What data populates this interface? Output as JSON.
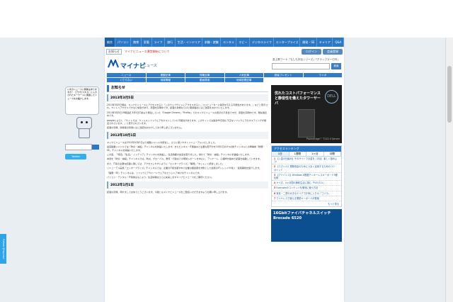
{
  "nav": [
    "総合",
    "パソコン",
    "携帯",
    "家電",
    "ライフ",
    "旅行",
    "生活・\nインテリア",
    "求職・就職",
    "エンタメ",
    "ホビー",
    "デジタル\nライフ",
    "エンター\nプライズ",
    "開発・SE",
    "キャリア",
    "Q&A"
  ],
  "topbar": {
    "tag": "お知らせ",
    "notice": "マイナビニュース運営開始について",
    "login": "ログイン",
    "register": "会員登録"
  },
  "logo": {
    "name": "マイナビ",
    "sub": "ニュース",
    "keyword_line": "急上昇ワード「もしも外伝シリーズ」「グラップラー刃牙」",
    "search_btn": "検索"
  },
  "cats": [
    "ニュース",
    "連載記事",
    "特集記事",
    "人気記事",
    "読者プレゼント",
    "マイボ",
    "くだらない",
    "地域情報",
    "動画検索",
    "地域密着記事"
  ],
  "page_title": "お知らせ",
  "posts": [
    {
      "date": "2013年3月5日",
      "paras": [
        "2013年3月5日現在、マイナビニュースにアクセスすると『このウェブサイトにアクセスすると、コンピューターに損害を与える可能性があります。』などと表示され、サイトへアクセスできない場合があり、原因を究明中です。読者の皆様ならびに関係各社にはご迷惑をおかけいたします。",
        "2013年3月5日19時追記\n3月5日午前より発生していた「Google Chrome」「Firefox」でのマイナビニュースの表示の不具合ですが、原因を究明中です。現在復旧中です。",
        "googleによると\n「サイトでは、ウイルスソフトウェアをホストしていた可能性があります。このサイトでは過去90日間に不正なソフトウェアのホスティングが検出されています。」と表示されています。",
        "読者の皆様、関係者の皆様にはご迷惑をおかけしており申し訳ございません。"
      ]
    },
    {
      "date": "2012年10月1日",
      "paras": [
        "マイナビニュースは2012年10月1日より複数ジャンルを統合し、さらに使いやすくリニューアルいたしました。",
        "従来掲載ジャンルでは「防災・減殺」チャンネルを新設いたします。またビジネス・IT関連など主要な若干分を10月1日の3つの新チャンネルとの再構成「総務・SE」チャンネルを開設いたします。",
        "この度、「特活」「生活」・インテリア」チャンネルを新設し、生活情報の充実を図りました。併せて「防災・減殺」チャンネルを開設いたします。",
        "本置を「防災・減殺」チャンネルでは、防災、グローバル、教育・行政などの現場レポートを中心に、アンケート、心理学を絡めた記事を掲載していきます。",
        "また、IT系の主要な記事に関しては、アクセスしやすいように「エンタープライズ」「開発」「ネット」に統合しました。",
        "リニューアル実施「エンタープライズ」チャンネルでは、企業のIT担当者や中小企業の経営者を対象とした最新のITトレンドや導入・運用事例を紹介します。",
        "「開発・SE」チャンネルは、ソフトウェアやハードウェアのエンジニア向けのチャンネルです。",
        "パソコン・デジタル・IT関係はもとより、生活情報はさらに充実しますマイナビニュースをご期待ください。"
      ]
    },
    {
      "date": "2012年1月1日",
      "paras": [
        "読者の皆様、明けましておめでとうございます。今後ともマイナビニュースをご愛読いただきますようお願い申し上げます。"
      ]
    }
  ],
  "ad1": {
    "text": "优れたコストパフォーマンスと静音性を備えたタワーサーバ",
    "brand": "DELL",
    "caption": "PowerEdge™ T110 II Server"
  },
  "ranking": {
    "title": "アクセスランキング",
    "tabs": [
      "1日",
      "1週間",
      "1ヶ月",
      "月間"
    ],
    "items": [
      {
        "no": "1",
        "text": "【入金の仕組み】そのサイトでお金を（ほぼ）楽しく始めよう!"
      },
      {
        "no": "2",
        "text": "【エクシル】業務改善のためにうまく活用するためのコツ・ポイント"
      },
      {
        "no": "3",
        "text": "【アドバンス】Windows 8搭載テンキーレスキーボード3種比較"
      },
      {
        "no": "4",
        "text": "ケイズ、4ヶ月間の節約生活に挑む「FiiO E11」"
      },
      {
        "no": "5",
        "text": "Evernoteのコンテンツを便利に使う方法"
      },
      {
        "no": "6",
        "text": "東京・二重の大きなエリアでお気に入りの「ゴジラ」"
      },
      {
        "no": "7",
        "text": "ワイヤレスで使える薄型キーボードが登場"
      }
    ],
    "more": "もっと見る"
  },
  "ad2": {
    "text": "16Gbitファイバチャネルスイッチ Brocade 6520"
  },
  "bot": {
    "bubble": "いまのニュースに興味はありますか？［アクセスする］に入力されたキーワードに関連したニュースをお届けします。",
    "follow": "Follow @mynavi"
  },
  "colors": {
    "nav": "#2a78c6",
    "accent": "#0a57a4"
  }
}
